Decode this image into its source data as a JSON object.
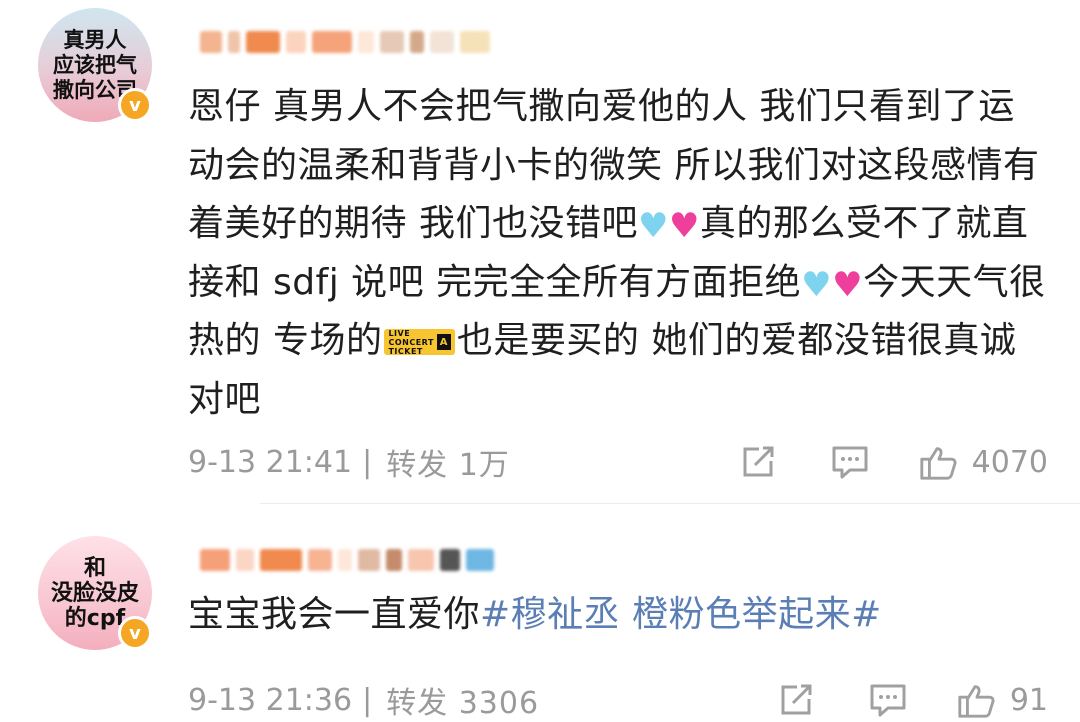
{
  "comments": [
    {
      "avatar_text": "真男人\n应该把气\n撒向公司",
      "badge": "v",
      "text_parts": {
        "p1": "恩仔 真男人不会把气撒向爱他的人 我们只看到了运动会的温柔和背背小卡的微笑 所以我们对这段感情有着美好的期待 我们也没错吧",
        "p2": "真的那么受不了就直接和 sdfj 说吧 完完全全所有方面拒绝",
        "p3": "今天天气很热的  专场的",
        "p4": "也是要买的 她们的爱都没错很真诚对吧"
      },
      "ticket_icon": {
        "line1": "LIVE",
        "line2": "CONCERT",
        "line3": "TICKET",
        "badge": "A"
      },
      "timestamp": "9-13 21:41",
      "separator": "|",
      "repost_label": "转发 1万",
      "likes": "4070",
      "icons": [
        "repost-icon",
        "comment-icon",
        "like-icon"
      ],
      "colors": {
        "heart_blue": "#7ed3ee",
        "heart_pink": "#ee3f9c"
      }
    },
    {
      "avatar_text": "和\n没脸没皮\n的cpf",
      "badge": "v",
      "text_parts": {
        "p1": "宝宝我会一直爱你",
        "hashtag": "#穆祉丞 橙粉色举起来#"
      },
      "timestamp": "9-13 21:36",
      "separator": "|",
      "repost_label": "转发 3306",
      "likes": "91",
      "icons": [
        "repost-icon",
        "comment-icon",
        "like-icon"
      ],
      "colors": {
        "hashtag": "#5b7fb5"
      }
    }
  ]
}
